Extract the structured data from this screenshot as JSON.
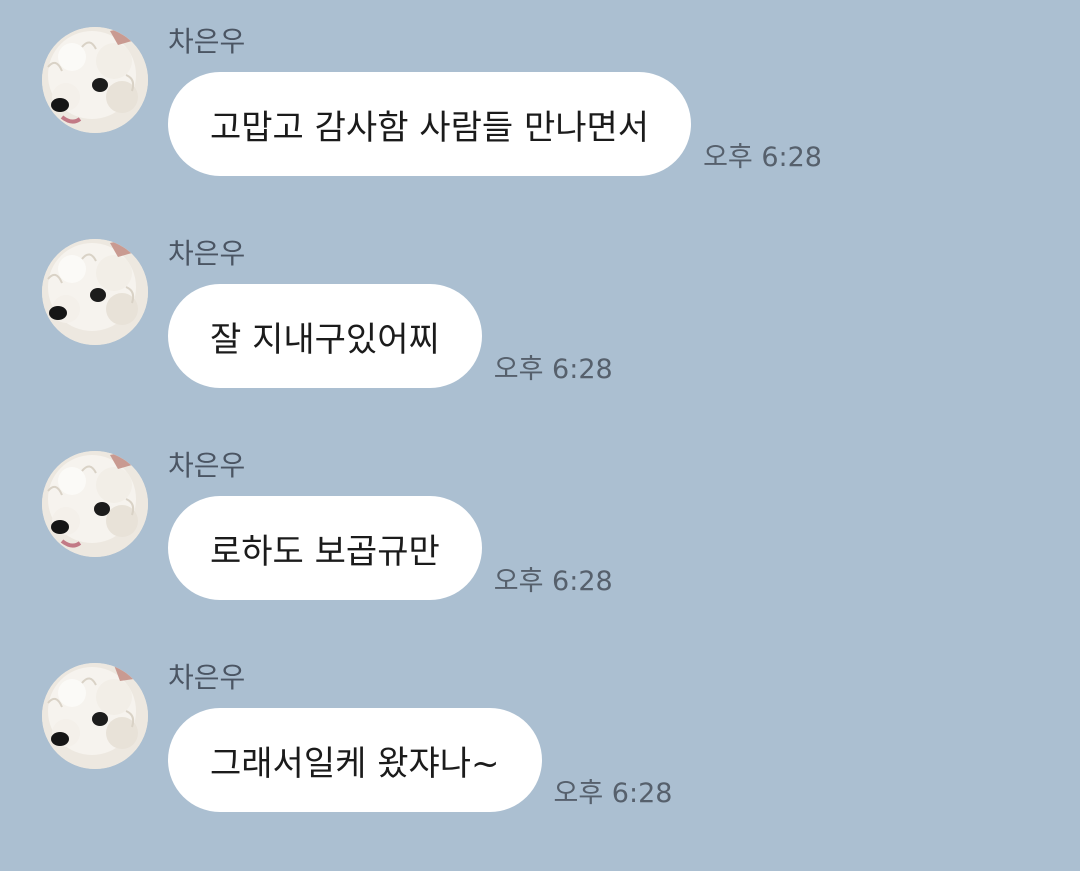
{
  "messages": [
    {
      "sender": "차은우",
      "text": "고맙고 감사함 사람들 만나면서",
      "time": "오후 6:28"
    },
    {
      "sender": "차은우",
      "text": "잘 지내구있어찌",
      "time": "오후 6:28"
    },
    {
      "sender": "차은우",
      "text": "로하도 보곱규만",
      "time": "오후 6:28"
    },
    {
      "sender": "차은우",
      "text": "그래서일케 왔쟈나~",
      "time": "오후 6:28"
    }
  ],
  "avatar_icon": "profile-photo-white-dog",
  "colors": {
    "background": "#abbfd1",
    "bubble": "#ffffff",
    "sender_text": "#4b5563",
    "time_text": "#56606c"
  }
}
